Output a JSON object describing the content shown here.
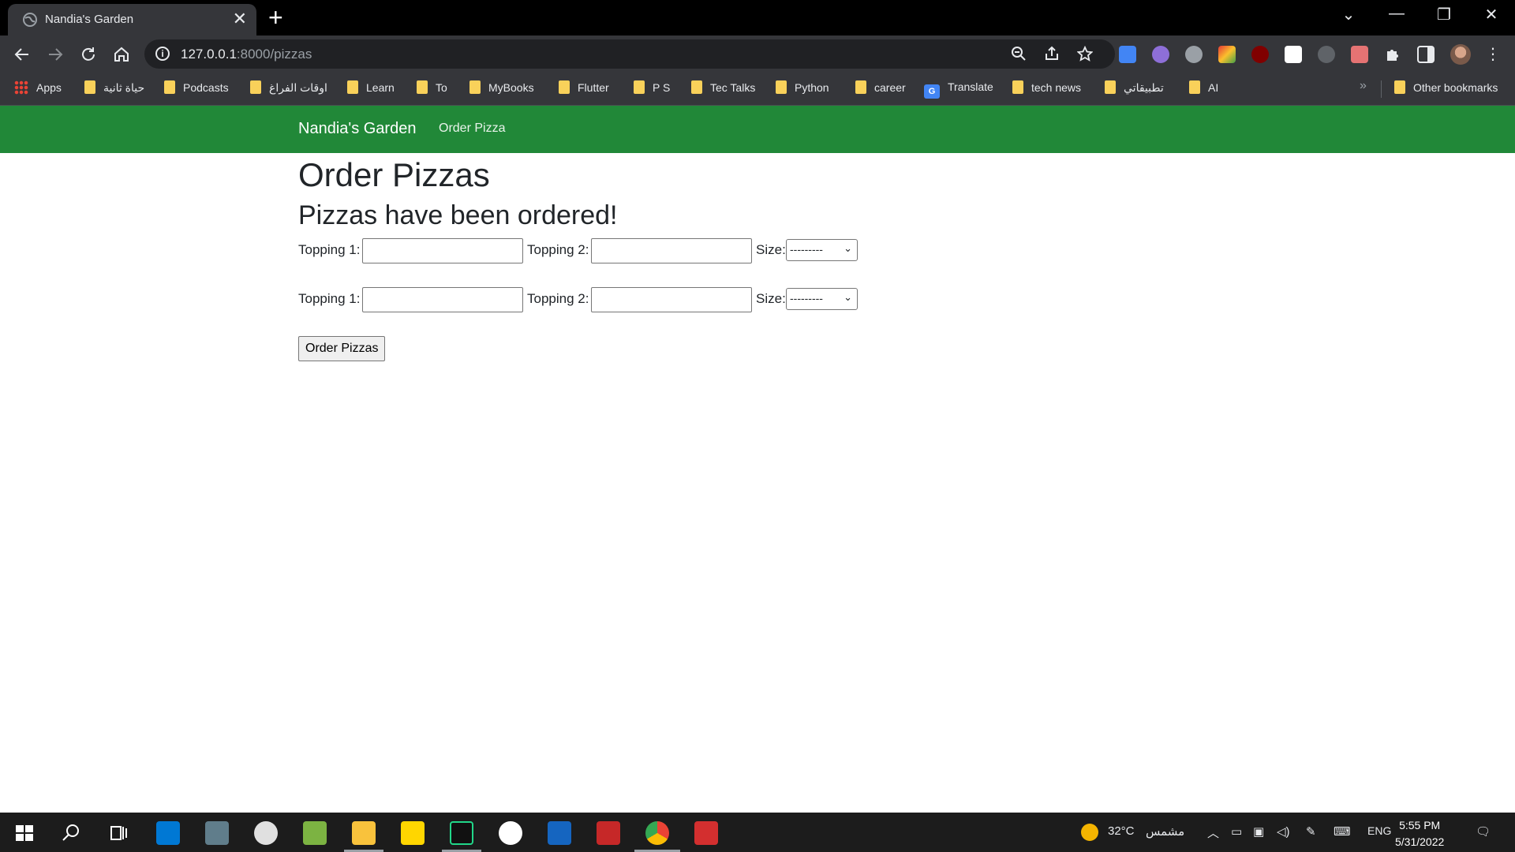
{
  "browser": {
    "tab_title": "Nandia's Garden",
    "tab_close": "✕",
    "new_tab": "+",
    "url_host": "127.0.0.1",
    "url_rest": ":8000/pizzas",
    "window_controls": [
      "⌄",
      "—",
      "❐",
      "✕"
    ]
  },
  "bookmarks": [
    {
      "label": "Apps",
      "icon": "apps-grid-icon"
    },
    {
      "label": "حياة ثانية",
      "icon": "folder-icon"
    },
    {
      "label": "Podcasts",
      "icon": "folder-icon"
    },
    {
      "label": "اوقات الفراغ",
      "icon": "folder-icon"
    },
    {
      "label": "Learn",
      "icon": "folder-icon"
    },
    {
      "label": "To",
      "icon": "folder-icon"
    },
    {
      "label": "MyBooks",
      "icon": "folder-icon"
    },
    {
      "label": "Flutter",
      "icon": "folder-icon"
    },
    {
      "label": "P S",
      "icon": "folder-icon"
    },
    {
      "label": "Tec Talks",
      "icon": "folder-icon"
    },
    {
      "label": "Python",
      "icon": "folder-icon"
    },
    {
      "label": "career",
      "icon": "folder-icon"
    },
    {
      "label": "Translate",
      "icon": "translate-icon"
    },
    {
      "label": "tech news",
      "icon": "folder-icon"
    },
    {
      "label": "تطبيقاتي",
      "icon": "folder-icon"
    },
    {
      "label": "AI",
      "icon": "folder-icon"
    }
  ],
  "bookmarks_more": "»",
  "other_bookmarks": "Other bookmarks",
  "page": {
    "brand": "Nandia's Garden",
    "nav_link": "Order Pizza",
    "heading": "Order Pizzas",
    "message": "Pizzas have been ordered!",
    "forms": [
      {
        "topping1_label": "Topping 1:",
        "topping1_value": "",
        "topping2_label": "Topping 2:",
        "topping2_value": "",
        "size_label": "Size:",
        "size_value": "---------"
      },
      {
        "topping1_label": "Topping 1:",
        "topping1_value": "",
        "topping2_label": "Topping 2:",
        "topping2_value": "",
        "size_label": "Size:",
        "size_value": "---------"
      }
    ],
    "submit_label": "Order Pizzas",
    "navbar_color": "#218838"
  },
  "taskbar": {
    "weather_temp": "32°C",
    "weather_text": "مشمس",
    "language": "ENG",
    "time": "5:55 PM",
    "date": "5/31/2022"
  }
}
